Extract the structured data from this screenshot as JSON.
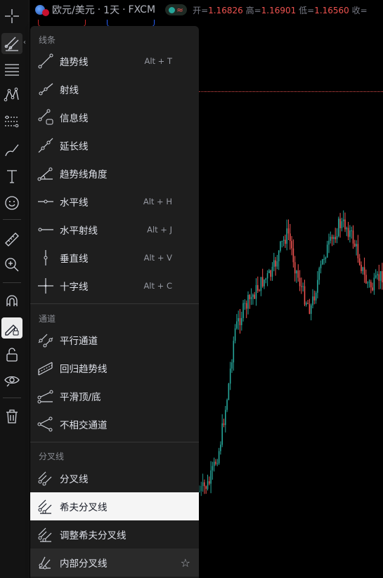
{
  "header": {
    "symbol": "欧元/美元",
    "interval": "1天",
    "exchange": "FXCM",
    "open_label": "开=",
    "open": "1.16826",
    "high_label": "高=",
    "high": "1.16901",
    "low_label": "低=",
    "low": "1.16560",
    "close_label": "收="
  },
  "toolbar": {
    "items": [
      {
        "icon": "crosshair-icon"
      },
      {
        "icon": "trendline-tools-icon",
        "active": true
      },
      {
        "icon": "fib-retracement-icon"
      },
      {
        "icon": "pattern-icon"
      },
      {
        "icon": "prediction-icon"
      },
      {
        "icon": "brush-icon"
      },
      {
        "icon": "text-icon"
      },
      {
        "icon": "emoji-icon"
      },
      {
        "icon": "ruler-icon"
      },
      {
        "icon": "zoom-in-icon"
      },
      {
        "icon": "magnet-icon"
      },
      {
        "icon": "stay-in-drawing-mode-icon"
      },
      {
        "icon": "lock-icon"
      },
      {
        "icon": "eye-icon"
      },
      {
        "icon": "trash-icon"
      }
    ]
  },
  "menu": {
    "sections": {
      "lines": "线条",
      "channels": "通道",
      "pitchforks": "分叉线"
    },
    "lines": [
      {
        "label": "趋势线",
        "shortcut": "Alt + T",
        "icon": "trend-line-icon"
      },
      {
        "label": "射线",
        "shortcut": "",
        "icon": "ray-icon"
      },
      {
        "label": "信息线",
        "shortcut": "",
        "icon": "info-line-icon"
      },
      {
        "label": "延长线",
        "shortcut": "",
        "icon": "extended-line-icon"
      },
      {
        "label": "趋势线角度",
        "shortcut": "",
        "icon": "trend-angle-icon"
      },
      {
        "label": "水平线",
        "shortcut": "Alt + H",
        "icon": "horizontal-line-icon"
      },
      {
        "label": "水平射线",
        "shortcut": "Alt + J",
        "icon": "horizontal-ray-icon"
      },
      {
        "label": "垂直线",
        "shortcut": "Alt + V",
        "icon": "vertical-line-icon"
      },
      {
        "label": "十字线",
        "shortcut": "Alt + C",
        "icon": "cross-line-icon"
      }
    ],
    "channels": [
      {
        "label": "平行通道",
        "icon": "parallel-channel-icon"
      },
      {
        "label": "回归趋势线",
        "icon": "regression-trend-icon"
      },
      {
        "label": "平滑顶/底",
        "icon": "flat-top-bottom-icon"
      },
      {
        "label": "不相交通道",
        "icon": "disjoint-channel-icon"
      }
    ],
    "pitchforks": [
      {
        "label": "分叉线",
        "icon": "pitchfork-icon"
      },
      {
        "label": "希夫分叉线",
        "icon": "schiff-pitchfork-icon",
        "selected": true
      },
      {
        "label": "调整希夫分叉线",
        "icon": "modified-schiff-pitchfork-icon"
      },
      {
        "label": "内部分叉线",
        "icon": "inside-pitchfork-icon",
        "hover": true,
        "favorite_icon": "star-icon"
      }
    ]
  },
  "colors": {
    "up": "#26a69a",
    "down": "#ef5350",
    "menu_bg": "#1e1e1e",
    "selected_bg": "#f5f5f5"
  }
}
